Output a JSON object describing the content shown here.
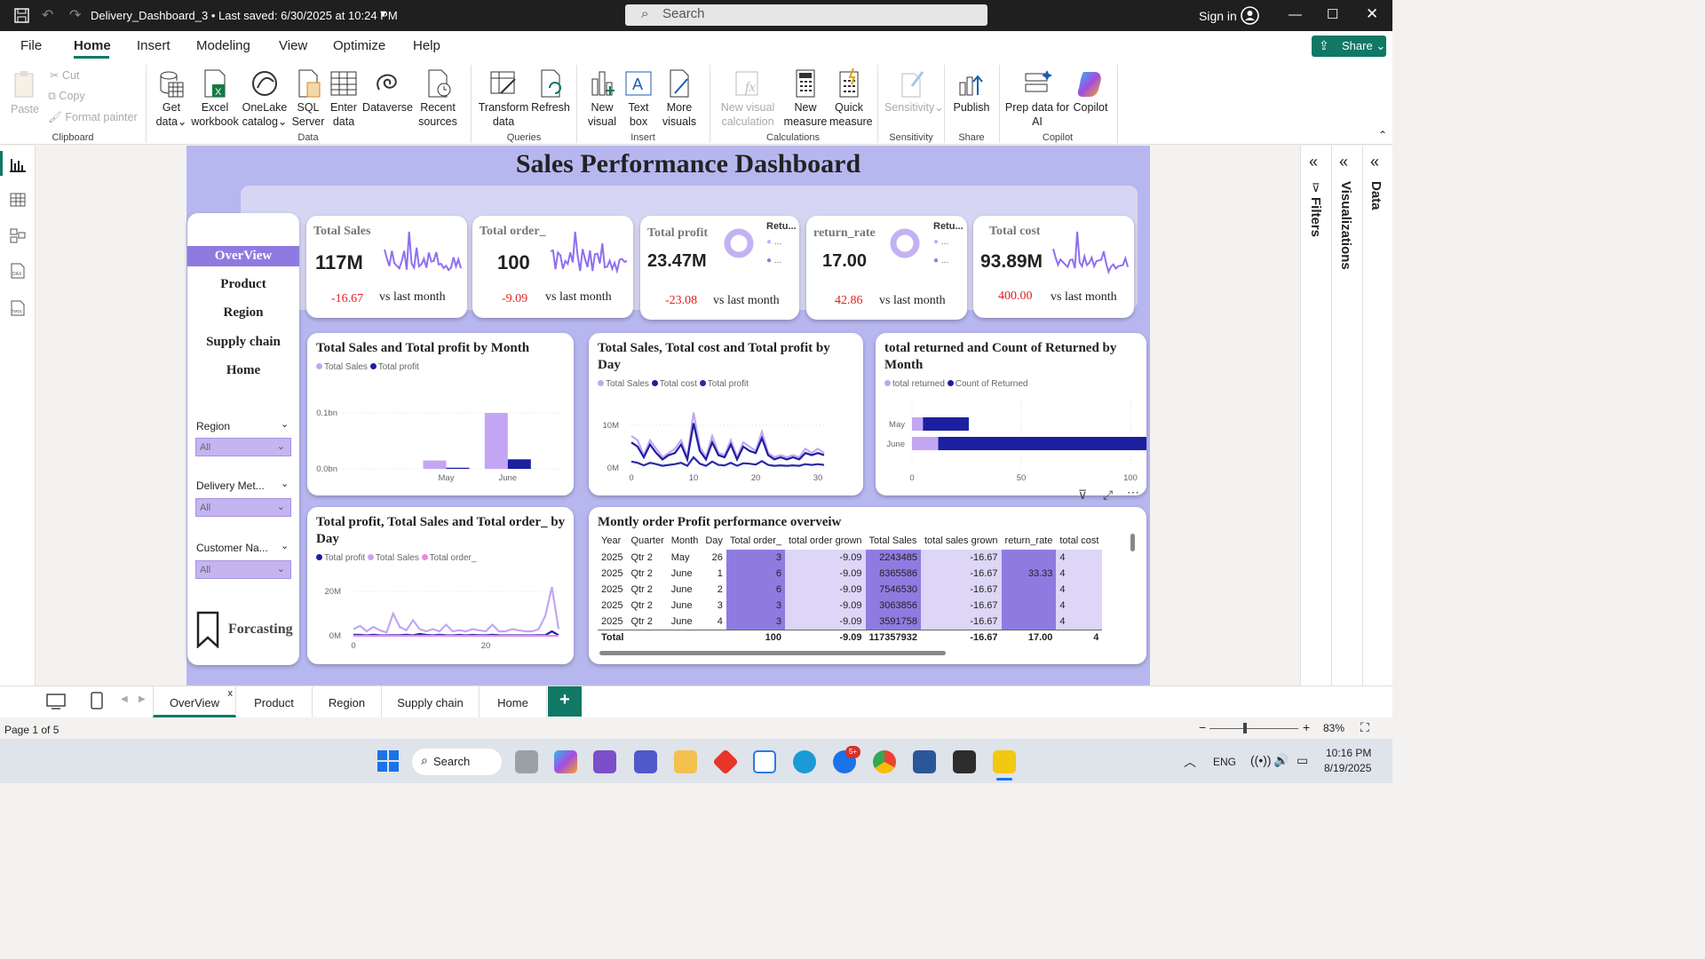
{
  "titlebar": {
    "doc_title": "Delivery_Dashboard_3 • Last saved: 6/30/2025 at 10:24 PM",
    "search_placeholder": "Search",
    "sign_in": "Sign in"
  },
  "menu": {
    "items": [
      "File",
      "Home",
      "Insert",
      "Modeling",
      "View",
      "Optimize",
      "Help"
    ],
    "active": "Home",
    "share": "Share"
  },
  "ribbon": {
    "clipboard": {
      "paste": "Paste",
      "cut": "Cut",
      "copy": "Copy",
      "format_painter": "Format painter",
      "group": "Clipboard"
    },
    "data": {
      "get_data": "Get data",
      "excel": "Excel workbook",
      "onelake": "OneLake catalog",
      "sql": "SQL Server",
      "enter": "Enter data",
      "dataverse": "Dataverse",
      "recent": "Recent sources",
      "group": "Data"
    },
    "queries": {
      "transform": "Transform data",
      "refresh": "Refresh",
      "group": "Queries"
    },
    "insert": {
      "new_visual": "New visual",
      "text_box": "Text box",
      "more_visuals": "More visuals",
      "group": "Insert"
    },
    "calculations": {
      "new_visual_calc": "New visual calculation",
      "new_measure": "New measure",
      "quick_measure": "Quick measure",
      "group": "Calculations"
    },
    "sensitivity": {
      "label": "Sensitivity",
      "group": "Sensitivity"
    },
    "share": {
      "publish": "Publish",
      "group": "Share"
    },
    "copilot": {
      "prep": "Prep data for AI",
      "copilot": "Copilot",
      "group": "Copilot"
    }
  },
  "dashboard": {
    "title": "Sales Performance Dashboard",
    "nav": [
      "OverView",
      "Product",
      "Region",
      "Supply chain",
      "Home"
    ],
    "nav_selected": "OverView",
    "slicers": [
      {
        "label": "Region",
        "value": "All"
      },
      {
        "label": "Delivery Met...",
        "value": "All"
      },
      {
        "label": "Customer Na...",
        "value": "All"
      }
    ],
    "forecasting": "Forcasting",
    "kpis": [
      {
        "title": "Total Sales",
        "value": "117M",
        "delta": "-16.67",
        "label": "vs last month"
      },
      {
        "title": "Total order_",
        "value": "100",
        "delta": "-9.09",
        "label": "vs last month"
      },
      {
        "title": "Total profit",
        "value": "23.47M",
        "delta": "-23.08",
        "label": "vs last month",
        "legend": "Retu..."
      },
      {
        "title": "return_rate",
        "value": "17.00",
        "delta": "42.86",
        "label": "vs last month",
        "legend": "Retu..."
      },
      {
        "title": "Total cost",
        "value": "93.89M",
        "delta": "400.00",
        "label": "vs last month"
      }
    ],
    "legend_ellipsis": "..."
  },
  "chart_data": [
    {
      "type": "bar",
      "title": "Total Sales and Total profit by Month",
      "categories": [
        "May",
        "June"
      ],
      "series": [
        {
          "name": "Total Sales",
          "values": [
            0.015,
            0.1
          ]
        },
        {
          "name": "Total profit",
          "values": [
            0.002,
            0.017
          ]
        }
      ],
      "ylim": [
        0,
        0.11
      ],
      "yticks": [
        "0.0bn",
        "0.1bn"
      ],
      "colors": [
        "#c3a6f3",
        "#1c1fa0"
      ]
    },
    {
      "type": "line",
      "title": "Total Sales, Total cost and Total profit by Day",
      "x": [
        0,
        1,
        2,
        3,
        4,
        5,
        6,
        7,
        8,
        9,
        10,
        11,
        12,
        13,
        14,
        15,
        16,
        17,
        18,
        19,
        20,
        21,
        22,
        23,
        24,
        25,
        26,
        27,
        28,
        29,
        30,
        31
      ],
      "series": [
        {
          "name": "Total Sales",
          "values": [
            7.5,
            6.5,
            3.0,
            6.5,
            4.5,
            2.5,
            3.5,
            4.5,
            6.5,
            2.5,
            13.0,
            5.0,
            2.5,
            7.5,
            3.5,
            3.0,
            6.5,
            2.5,
            6.0,
            5.0,
            4.0,
            8.5,
            3.5,
            2.5,
            3.0,
            2.5,
            3.0,
            2.5,
            4.5,
            3.5,
            4.5,
            3.5
          ]
        },
        {
          "name": "Total cost",
          "values": [
            6.0,
            5.0,
            2.5,
            5.5,
            3.5,
            2.0,
            3.0,
            3.5,
            5.5,
            2.0,
            10.5,
            4.0,
            2.0,
            6.0,
            3.0,
            2.5,
            5.5,
            2.0,
            5.0,
            4.0,
            3.5,
            7.0,
            3.0,
            2.0,
            2.5,
            2.0,
            2.5,
            2.0,
            3.5,
            3.0,
            3.5,
            3.0
          ]
        },
        {
          "name": "Total profit",
          "values": [
            1.5,
            1.2,
            0.6,
            1.2,
            0.9,
            0.5,
            0.7,
            0.9,
            1.2,
            0.5,
            2.5,
            1.0,
            0.5,
            1.5,
            0.7,
            0.6,
            1.2,
            0.5,
            1.1,
            1.0,
            0.8,
            1.6,
            0.7,
            0.5,
            0.6,
            0.5,
            0.6,
            0.5,
            0.9,
            0.7,
            0.9,
            0.7
          ]
        }
      ],
      "ylim": [
        0,
        15
      ],
      "yticks": [
        "0M",
        "10M"
      ],
      "xticks": [
        "0",
        "10",
        "20",
        "30"
      ],
      "colors": [
        "#c3a6f3",
        "#1c1fa0",
        "#2a2aa8"
      ]
    },
    {
      "type": "bar",
      "orientation": "horizontal",
      "title": "total returned and Count of Returned by Month",
      "categories": [
        "May",
        "June"
      ],
      "series": [
        {
          "name": "total returned",
          "values": [
            5,
            12
          ]
        },
        {
          "name": "Count of Returned",
          "values": [
            21,
            96
          ]
        }
      ],
      "xlim": [
        0,
        100
      ],
      "xticks": [
        "0",
        "50",
        "100"
      ],
      "colors": [
        "#c3a6f3",
        "#1c1fa0"
      ]
    },
    {
      "type": "line",
      "title": "Total profit, Total Sales and Total order_ by Day",
      "x": [
        0,
        1,
        2,
        3,
        4,
        5,
        6,
        7,
        8,
        9,
        10,
        11,
        12,
        13,
        14,
        15,
        16,
        17,
        18,
        19,
        20,
        21,
        22,
        23,
        24,
        25,
        26,
        27,
        28,
        29,
        30,
        31
      ],
      "series": [
        {
          "name": "Total profit",
          "values": [
            0.5,
            0.4,
            0.2,
            0.5,
            0.3,
            0.2,
            0.3,
            0.3,
            0.5,
            0.2,
            0.8,
            0.4,
            0.2,
            0.5,
            0.3,
            0.2,
            0.4,
            0.2,
            0.4,
            0.3,
            0.3,
            0.5,
            0.3,
            0.2,
            0.2,
            0.2,
            0.2,
            0.2,
            0.3,
            0.3,
            2.0,
            0.3
          ]
        },
        {
          "name": "Total Sales",
          "values": [
            3,
            4.5,
            2,
            4,
            2.5,
            1.5,
            10,
            4,
            2.5,
            7,
            3,
            2,
            3,
            2,
            5,
            2,
            2.5,
            2,
            3,
            2.5,
            2,
            5,
            2,
            2,
            3,
            2.5,
            2,
            2,
            3,
            9,
            22,
            3
          ]
        },
        {
          "name": "Total order_",
          "values": [
            0,
            0,
            0,
            0,
            0,
            0,
            0,
            0,
            0,
            0,
            0,
            0,
            0,
            0,
            0,
            0,
            0,
            0,
            0,
            0,
            0,
            0,
            0,
            0,
            0,
            0,
            0,
            0,
            0,
            0,
            0,
            0
          ]
        }
      ],
      "ylim": [
        0,
        30
      ],
      "yticks": [
        "0M",
        "20M"
      ],
      "xticks": [
        "0",
        "20"
      ],
      "colors": [
        "#1c1fa0",
        "#c3a6f3",
        "#e88be0"
      ]
    }
  ],
  "table": {
    "title": "Montly order Profit performance overveiw",
    "columns": [
      "Year",
      "Quarter",
      "Month",
      "Day",
      "Total order_",
      "total order grown",
      "Total Sales",
      "total sales grown",
      "return_rate",
      "total cost"
    ],
    "rows": [
      [
        "2025",
        "Qtr 2",
        "May",
        "26",
        "3",
        "-9.09",
        "2243485",
        "-16.67",
        "",
        "4"
      ],
      [
        "2025",
        "Qtr 2",
        "June",
        "1",
        "6",
        "-9.09",
        "8365586",
        "-16.67",
        "33.33",
        "4"
      ],
      [
        "2025",
        "Qtr 2",
        "June",
        "2",
        "6",
        "-9.09",
        "7546530",
        "-16.67",
        "",
        "4"
      ],
      [
        "2025",
        "Qtr 2",
        "June",
        "3",
        "3",
        "-9.09",
        "3063856",
        "-16.67",
        "",
        "4"
      ],
      [
        "2025",
        "Qtr 2",
        "June",
        "4",
        "3",
        "-9.09",
        "3591758",
        "-16.67",
        "",
        "4"
      ]
    ],
    "total": [
      "Total",
      "",
      "",
      "",
      "100",
      "-9.09",
      "117357932",
      "-16.67",
      "17.00",
      "4"
    ]
  },
  "panes": {
    "filters": "Filters",
    "visualizations": "Visualizations",
    "data": "Data"
  },
  "pages": {
    "tabs": [
      "OverView",
      "Product",
      "Region",
      "Supply chain",
      "Home"
    ],
    "selected": "OverView",
    "add": "+"
  },
  "status": {
    "page": "Page 1 of 5",
    "zoom": "83%"
  },
  "taskbar": {
    "search": "Search",
    "lang": "ENG",
    "time": "10:16 PM",
    "date": "8/19/2025",
    "badge": "5+"
  }
}
